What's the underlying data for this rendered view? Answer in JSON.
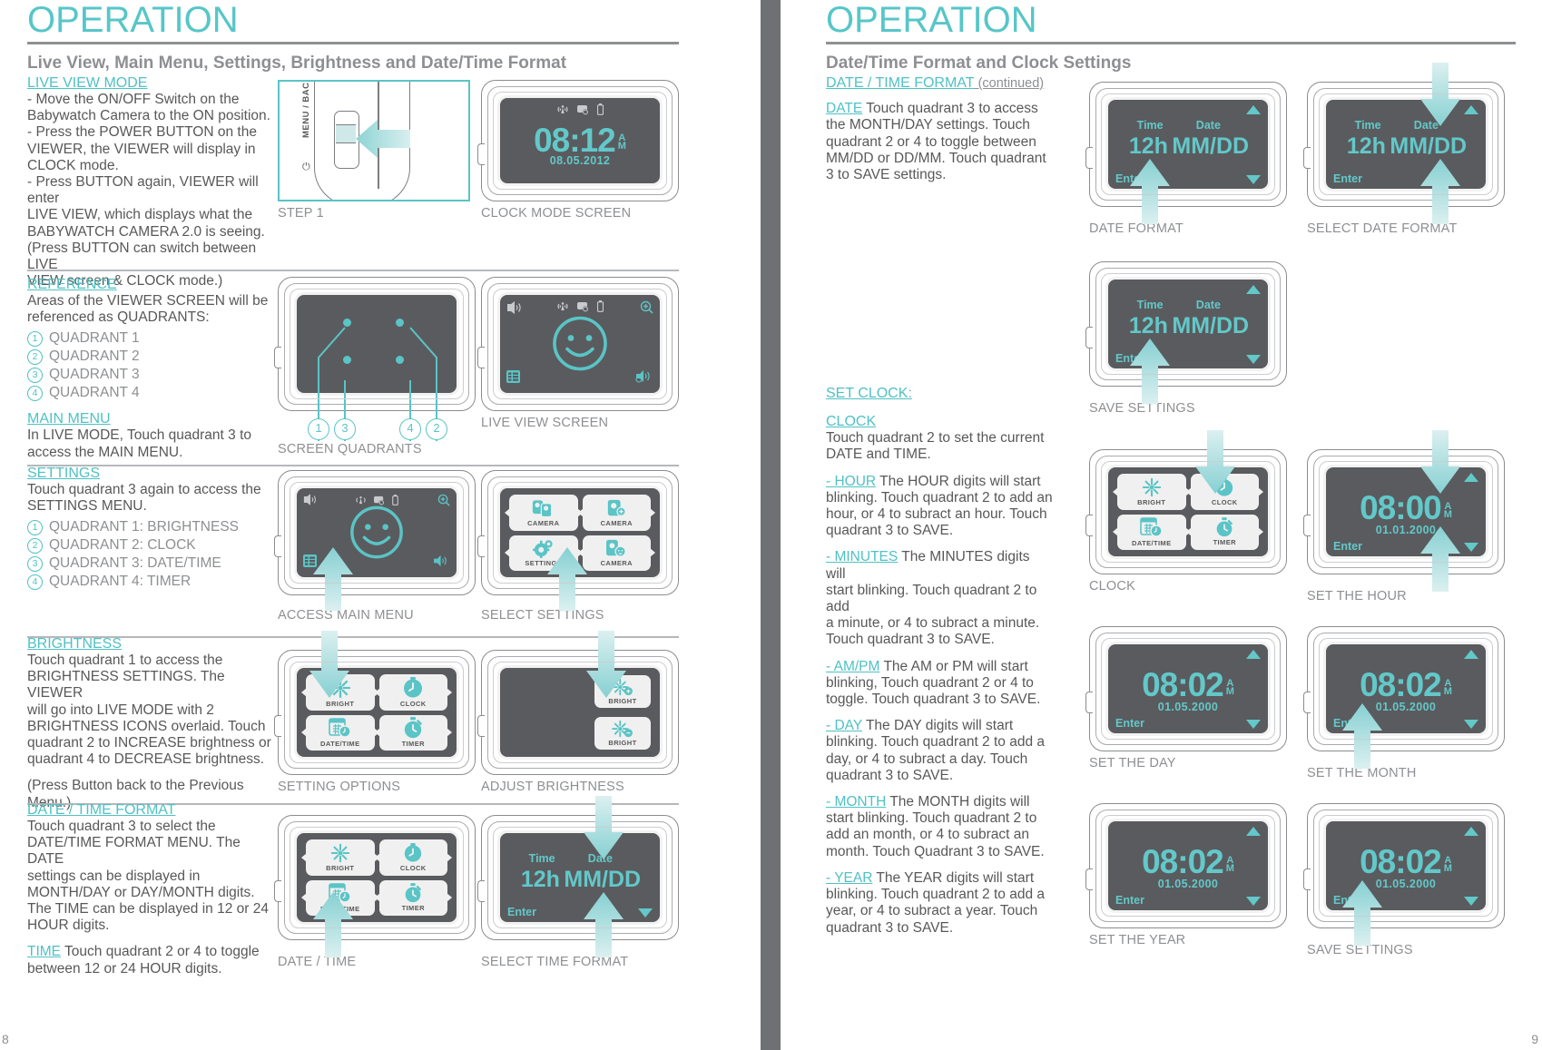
{
  "left_page": {
    "title": "OPERATION",
    "subtitle": "Live View, Main Menu, Settings, Brightness and Date/Time Format",
    "page_number": "8",
    "sections": [
      {
        "heading": "LIVE VIEW MODE",
        "body": "- Move the ON/OFF Switch on the Babywatch Camera to the ON position.\n- Press the POWER BUTTON on the VIEWER, the VIEWER will display in CLOCK mode.\n- Press BUTTON again, VIEWER will enter LIVE VIEW, which displays what the BABYWATCH CAMERA 2.0 is seeing.\n(Press BUTTON can switch between LIVE VIEW screen & CLOCK mode.)"
      },
      {
        "heading": "REFERENCE",
        "body": "Areas of the VIEWER SCREEN will be referenced as QUADRANTS:",
        "quadrants": [
          "QUADRANT 1",
          "QUADRANT 2",
          "QUADRANT 3",
          "QUADRANT 4"
        ],
        "heading2": "MAIN MENU",
        "body2": "In LIVE MODE, Touch quadrant 3 to access the MAIN MENU."
      },
      {
        "heading": "SETTINGS",
        "body": "Touch quadrant 3 again to access the SETTINGS MENU.",
        "quadrants": [
          "QUADRANT 1: BRIGHTNESS",
          "QUADRANT 2: CLOCK",
          "QUADRANT 3: DATE/TIME",
          "QUADRANT 4: TIMER"
        ]
      },
      {
        "heading": "BRIGHTNESS",
        "body": "Touch quadrant 1 to access the BRIGHTNESS SETTINGS. The VIEWER will go into LIVE MODE with 2 BRIGHTNESS ICONS overlaid. Touch quadrant 2 to INCREASE brightness or quadrant 4 to DECREASE brightness.",
        "body2": "(Press Button back to the Previous Menu.)"
      },
      {
        "heading": "DATE / TIME FORMAT",
        "body": "Touch quadrant 3 to select the DATE/TIME FORMAT MENU. The DATE settings can be displayed in MONTH/DAY or DAY/MONTH digits. The TIME can be displayed in 12 or 24 HOUR digits.",
        "inline_heading": "TIME",
        "body2": " Touch quadrant 2 or 4 to toggle between 12 or 24 HOUR digits."
      }
    ],
    "figures": {
      "step1_caption": "STEP 1",
      "step1_button_label": "MENU / BACK",
      "clock_caption": "CLOCK MODE SCREEN",
      "clock_time": "08:12",
      "clock_ampm_a": "A",
      "clock_ampm_m": "M",
      "clock_date": "08.05.2012",
      "quadrants_caption": "SCREEN QUADRANTS",
      "quadrant_numbers": [
        "1",
        "3",
        "4",
        "2"
      ],
      "liveview_caption": "LIVE VIEW SCREEN",
      "mainmenu_caption": "ACCESS MAIN MENU",
      "settings_caption": "SELECT SETTINGS",
      "setting_options_caption": "SETTING OPTIONS",
      "adjust_brightness_caption": "ADJUST BRIGHTNESS",
      "datetime_caption": "DATE / TIME",
      "select_time_format_caption": "SELECT TIME FORMAT",
      "menu_items_settings": [
        "CAMERA",
        "CAMERA",
        "SETTINGS",
        "CAMERA"
      ],
      "menu_items_options": [
        "BRIGHT",
        "CLOCK",
        "DATE/TIME",
        "TIMER"
      ],
      "brightness_icons": [
        "BRIGHT",
        "BRIGHT"
      ],
      "format_time_label": "Time",
      "format_date_label": "Date",
      "format_time_value": "12h",
      "format_date_value": "MM/DD",
      "format_enter": "Enter"
    }
  },
  "right_page": {
    "title": "OPERATION",
    "subtitle": "Date/Time Format and Clock Settings",
    "page_number": "9",
    "sections": [
      {
        "heading": "DATE / TIME FORMAT",
        "heading_suffix": " (continued)",
        "inline_heading": "DATE",
        "body": "  Touch quadrant 3 to access the MONTH/DAY settings. Touch quadrant 2 or 4 to toggle between MM/DD or DD/MM. Touch quadrant 3 to SAVE settings."
      },
      {
        "heading": "SET CLOCK:",
        "heading2": "CLOCK",
        "body": "Touch quadrant 2 to set the current DATE and TIME.",
        "items": [
          {
            "label": "- HOUR",
            "text": "  The HOUR digits will start blinking. Touch quadrant 2 to add an hour, or 4 to subract an hour. Touch quadrant 3 to SAVE."
          },
          {
            "label": "- MINUTES",
            "text": "   The MINUTES digits will start blinking. Touch quadrant 2 to add a minute, or 4 to subract a minute. Touch quadrant 3 to SAVE."
          },
          {
            "label": "- AM/PM",
            "text": "  The AM or PM will start blinking, Touch quadrant 2 or 4 to toggle. Touch quadrant 3 to SAVE."
          },
          {
            "label": "- DAY",
            "text": "  The DAY digits will start blinking. Touch quadrant 2 to add a day, or 4 to subract a day. Touch quadrant 3 to SAVE."
          },
          {
            "label": "- MONTH",
            "text": "  The MONTH digits will start blinking. Touch quadrant 2 to add an month, or 4 to subract an month. Touch Quadrant 3 to SAVE."
          },
          {
            "label": "- YEAR",
            "text": "  The YEAR digits will start blinking. Touch quadrant 2 to add a year, or 4 to subract a year. Touch quadrant 3 to SAVE."
          }
        ]
      }
    ],
    "figures": {
      "date_format_caption": "DATE FORMAT",
      "select_date_format_caption": "SELECT DATE FORMAT",
      "save_settings_caption": "SAVE SETTINGS",
      "clock_caption": "CLOCK",
      "set_hour_caption": "SET THE HOUR",
      "set_day_caption": "SET THE DAY",
      "set_month_caption": "SET THE MONTH",
      "set_year_caption": "SET THE YEAR",
      "save_settings_caption2": "SAVE SETTINGS",
      "format_time_label": "Time",
      "format_date_label": "Date",
      "format_time_value": "12h",
      "format_date_value": "MM/DD",
      "format_enter": "Enter",
      "menu_items_clock": [
        "BRIGHT",
        "CLOCK",
        "DATE/TIME",
        "TIMER"
      ],
      "hour_time": "08:00",
      "hour_date": "01.01.2000",
      "clock_time": "08:02",
      "clock_date": "01.05.2000",
      "ampm_a": "A",
      "ampm_m": "M",
      "enter_label": "Enter"
    }
  },
  "colors": {
    "accent": "#4fc1c4",
    "screen_accent": "#62c8c9",
    "body_text": "#58585a",
    "muted": "#8d8f92",
    "screen_bg": "#5a5b5e",
    "spine": "#6f7073"
  }
}
